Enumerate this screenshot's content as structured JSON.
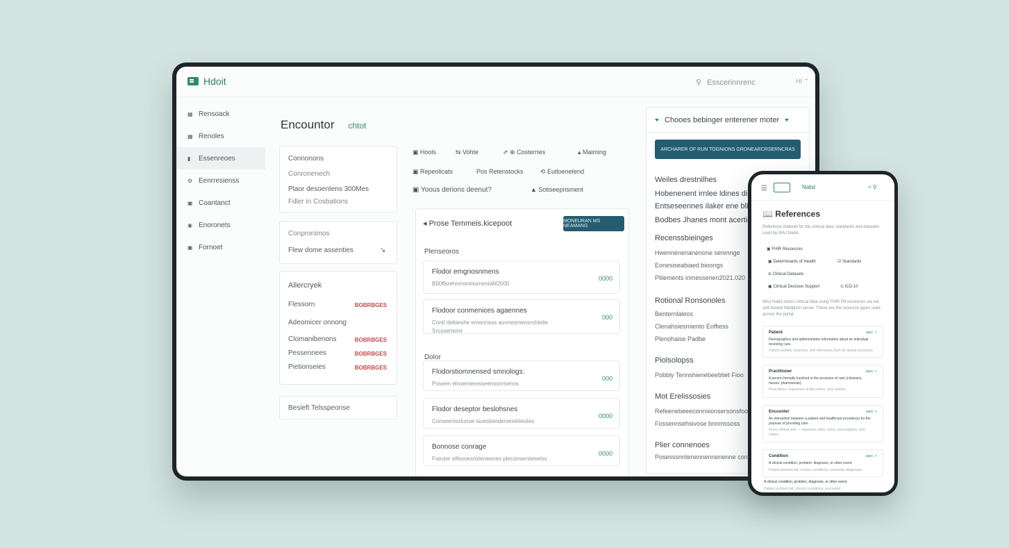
{
  "colors": {
    "background": "#d3e4e0",
    "accent": "#2e8b6a",
    "button": "#245d70",
    "badge": "#c44a48"
  },
  "app": {
    "brand": "Hdoit",
    "search_placeholder": "Esscerinnrenc",
    "topbar_icons": "HI ⌃"
  },
  "sidebar": {
    "items": [
      {
        "icon": "calendar-icon",
        "glyph": "▦",
        "label": "Rensoack"
      },
      {
        "icon": "grid-icon",
        "glyph": "▦",
        "label": "Renoles"
      },
      {
        "icon": "bars-icon",
        "glyph": "▮",
        "label": "Essenreoes",
        "active": true
      },
      {
        "icon": "gear-icon",
        "glyph": "⚙",
        "label": "Eenrresienss"
      },
      {
        "icon": "contact-icon",
        "glyph": "▣",
        "label": "Coantanct"
      },
      {
        "icon": "globe-icon",
        "glyph": "◉",
        "label": "Enoronets"
      },
      {
        "icon": "folder-icon",
        "glyph": "▣",
        "label": "Fornoet"
      }
    ]
  },
  "header": {
    "title": "Encountor",
    "tag": "chtot"
  },
  "left_cards": {
    "card1": [
      "Connonons",
      "Conronenech",
      "Plaor desoentens 300Mes",
      "Fdler in Cosbations"
    ],
    "card2": {
      "title": "Conpronimos",
      "row": "Flew dome assenties",
      "arrow": "↘"
    },
    "card3": {
      "title": "Allercryek",
      "rows": [
        {
          "label": "Flessorn",
          "badge": "BOBRBGES"
        },
        {
          "label": "Adeomicer onnong",
          "badge": ""
        },
        {
          "label": "Clomanibenons",
          "badge": "BOBRBGES"
        },
        {
          "label": "Pessennees",
          "badge": "BOBRBGES"
        },
        {
          "label": "Pietionseies",
          "badge": "BOBRBGES"
        }
      ]
    },
    "card4": "Besieft Telsspeonse"
  },
  "chips": {
    "row1": [
      "Hools",
      "Vohte",
      "Costerries",
      "Maiming"
    ],
    "row2": [
      "Repeolicats",
      "Pos Retenstocks",
      "Eutloenetend"
    ],
    "row3": [
      "Yoous derions deenut?",
      "Sotiseeprisment"
    ]
  },
  "middle": {
    "header": "Prose Temmeis.kicepoot",
    "button": "MONEURAN MS NEAMANG",
    "section1": "Plenseoros",
    "section2": "Dolor",
    "cards": [
      {
        "title": "Flodor emgnosnmens",
        "sub": "B00ffsrehnmonniurneniaM2000",
        "sub2": "",
        "value": "0000"
      },
      {
        "title": "Flodoor conmenices agaennes",
        "sub": "Contl iilebieshe emenness aunnesmensrshtelie",
        "sub2": "Srossenions",
        "value": "000"
      },
      {
        "title": "Flodorstiomnensed smnologs:",
        "sub": "Poseen elnoemeresseenssnrsenos",
        "sub2": "",
        "value": "000"
      },
      {
        "title": "Flodor deseptor beslohsnes",
        "sub": "Conseenisslunue isuesliandenereetiestes",
        "sub2": "",
        "value": "0000"
      },
      {
        "title": "Bonnose conrage",
        "sub": "Fseuler elfesnesnsteneenes pleconsersteseiss .",
        "sub2": "",
        "value": "0000"
      }
    ]
  },
  "right": {
    "select": "Chooes bebinger enterener moter",
    "button": "ARCHARER OF RUN TOGNIONS GRONEARCRSERNCRAS",
    "groups": [
      {
        "title": "Weiles drestnilhes",
        "lines": []
      },
      {
        "title": "Hobenenent irnlee ldines di",
        "lines": []
      },
      {
        "title": "Entseseennes ilaker ene blisc",
        "lines": []
      },
      {
        "title": "Bodbes Jhanes mont acertiero",
        "lines": []
      },
      {
        "title": "Recenssbieinges",
        "lines": [
          "Hwennenenanenone senmnge",
          "Eonesiseabiaed bioongs",
          "Plilements inmessenen2021.020"
        ]
      },
      {
        "title": "Rotional Ronsonoles",
        "lines": [
          "Benternlaleos",
          "Clenahsiesmiento Eoffiess",
          "Plenohaise Padbe"
        ]
      },
      {
        "title": "Piolsolopss",
        "lines": [
          "Pobbly Tennshienebeebtiet Fioo"
        ]
      },
      {
        "title": "Mot Erelissosies",
        "lines": [
          "Refeenebeeeconnsionsersonsfoo",
          "Fossennsehsivose bnnmssoss"
        ]
      },
      {
        "title": "Plier connenoes",
        "lines": [
          "Posesssnntenennennenenne con"
        ]
      }
    ]
  },
  "phone": {
    "brand": "Nabd",
    "title": "References",
    "description": "Reference material for the clinical data, standards and datasets used by WAJ Nabd.",
    "links": [
      "FHIR Resources",
      "Determinants of Health",
      "Standards",
      "Clinical Datasets",
      "Clinical Decision Support",
      "ICD-10"
    ],
    "intro": "WAJ Nabd stores clinical data using FHIR R4 resources via our self-hosted Medplum server. These are the resource types used across the portal.",
    "spec_label": "spec ↗",
    "cards": [
      {
        "title": "Patient",
        "text": "Demographics and administrative information about an individual receiving care.",
        "meta": "Patient profiles, searches, and references from all clinical resources"
      },
      {
        "title": "Practitioner",
        "text": "A person formally involved in the provision of care (clinicians, nurses, pharmacists).",
        "meta": "Prescribers, requesters of lab orders, note authors"
      },
      {
        "title": "Encounter",
        "text": "An interaction between a patient and healthcare provider(s) for the purpose of providing care.",
        "meta": "Every clinical visit — organizes visits, notes, prescriptions, and orders."
      },
      {
        "title": "Condition",
        "text": "A clinical condition, problem, diagnosis, or other event.",
        "meta": "Patient problem list, chronic conditions, encounter diagnoses"
      }
    ],
    "footer_text": "A clinical condition, problem, diagnosis, or other event.",
    "footer_meta": "Patient problem list, chronic conditions, encounter"
  }
}
